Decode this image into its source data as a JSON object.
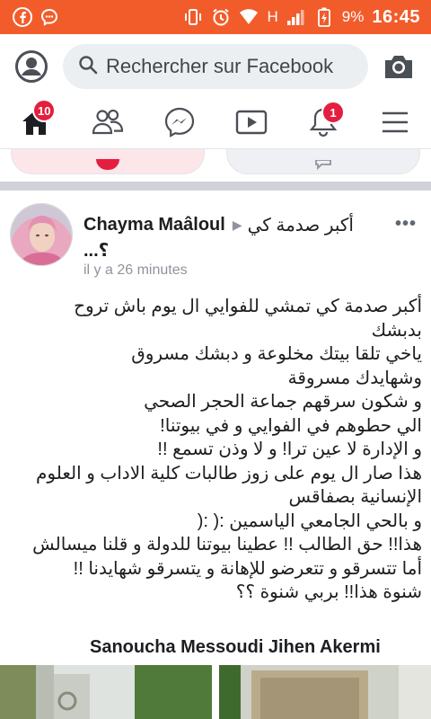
{
  "status_bar": {
    "signal_label": "H",
    "battery": "9%",
    "time": "16:45"
  },
  "search": {
    "placeholder": "Rechercher sur Facebook"
  },
  "nav": {
    "tabs": [
      {
        "icon": "home-icon",
        "badge": "10"
      },
      {
        "icon": "friends-icon",
        "badge": ""
      },
      {
        "icon": "messenger-icon",
        "badge": ""
      },
      {
        "icon": "watch-icon",
        "badge": ""
      },
      {
        "icon": "notifications-icon",
        "badge": "1"
      },
      {
        "icon": "menu-icon",
        "badge": ""
      }
    ]
  },
  "post": {
    "author": "Chayma Maâloul",
    "header_text": "أكبر صدمة كي",
    "header_text_cont": "...؟",
    "time": "il y a 26 minutes",
    "lines": [
      "أكبر صدمة كي تمشي للفوايي ال يوم باش تروح",
      "بدبشك",
      "ياخي تلقا بيتك مخلوعة و دبشك مسروق",
      "وشهايدك مسروقة",
      "و شكون سرقهم جماعة الحجر الصحي",
      "الي حطوهم في الفوايي و في بيوتنا!",
      "و الإدارة لا عين ترا! و لا وذن تسمع !!",
      "هذا صار ال يوم على زوز طالبات كلية الاداب و العلوم",
      "الإنسانية بصفاقس",
      "و بالحي الجامعي الياسمين :( :(",
      "هذا!! حق الطالب !! عطينا بيوتنا للدولة و قلنا ميسالش",
      "أما تتسرقو و تتعرضو للإهانة و يتسرقو شهايدنا !!",
      "شنوة هذا!! بربي شنوة ؟؟"
    ],
    "signature": "Sanoucha Messoudi Jihen Akermi"
  },
  "colors": {
    "status_bar": "#f25c2b",
    "badge": "#e41e3f",
    "text": "#1c1e21",
    "muted": "#90949c"
  }
}
